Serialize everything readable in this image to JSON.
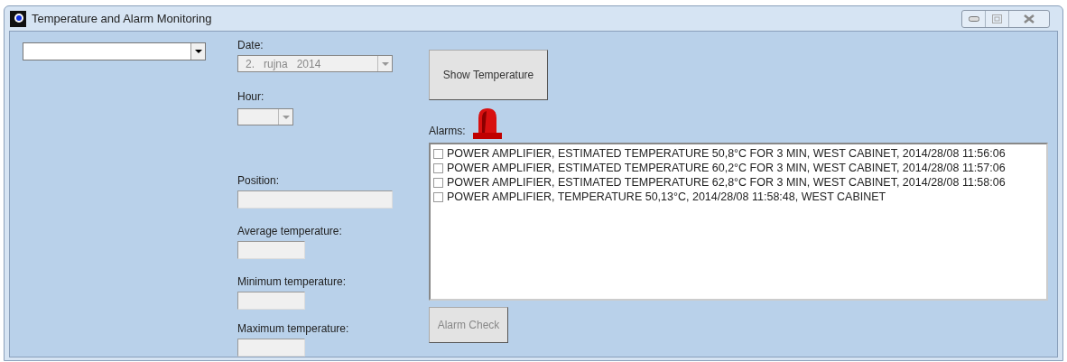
{
  "window": {
    "title": "Temperature and Alarm Monitoring"
  },
  "date": {
    "label": "Date:",
    "value": "2.   rujna   2014",
    "disabled": true
  },
  "hour": {
    "label": "Hour:",
    "disabled": true
  },
  "fields": [
    {
      "label": "Position:",
      "wide": true
    },
    {
      "label": "Average temperature:",
      "wide": false
    },
    {
      "label": "Minimum temperature:",
      "wide": false
    },
    {
      "label": "Maximum temperature:",
      "wide": false
    }
  ],
  "show_button": {
    "label": "Show Temperature"
  },
  "alarms": {
    "label": "Alarms:",
    "active": true,
    "items": [
      {
        "text": "POWER AMPLIFIER, ESTIMATED TEMPERATURE 50,8°C FOR 3 MIN, WEST CABINET, 2014/28/08 11:56:06",
        "checked": false
      },
      {
        "text": "POWER AMPLIFIER, ESTIMATED TEMPERATURE 60,2°C FOR 3 MIN, WEST CABINET, 2014/28/08 11:57:06",
        "checked": false
      },
      {
        "text": "POWER AMPLIFIER, ESTIMATED TEMPERATURE 62,8°C FOR 3 MIN, WEST CABINET, 2014/28/08 11:58:06",
        "checked": false
      },
      {
        "text": "POWER AMPLIFIER, TEMPERATURE 50,13°C, 2014/28/08 11:58:48, WEST CABINET",
        "checked": false
      }
    ]
  },
  "check_button": {
    "label": "Alarm Check",
    "disabled": true
  }
}
